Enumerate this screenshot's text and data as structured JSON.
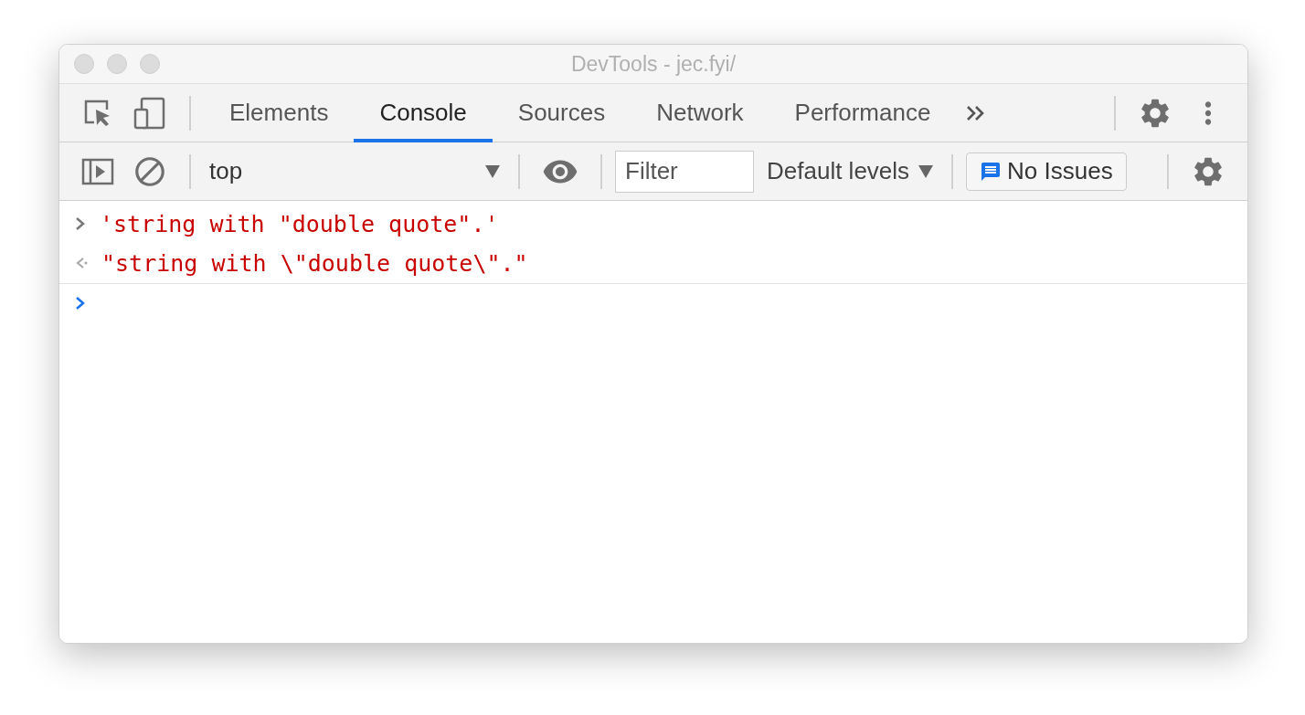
{
  "window": {
    "title": "DevTools - jec.fyi/"
  },
  "tabs": [
    {
      "label": "Elements",
      "selected": false
    },
    {
      "label": "Console",
      "selected": true
    },
    {
      "label": "Sources",
      "selected": false
    },
    {
      "label": "Network",
      "selected": false
    },
    {
      "label": "Performance",
      "selected": false
    }
  ],
  "toolbar": {
    "context": "top",
    "filter": {
      "placeholder": "Filter"
    },
    "levels": "Default levels",
    "issues": "No Issues"
  },
  "console": [
    {
      "kind": "input",
      "text": "'string with \"double quote\".'"
    },
    {
      "kind": "output",
      "text": "\"string with \\\"double quote\\\".\""
    }
  ]
}
